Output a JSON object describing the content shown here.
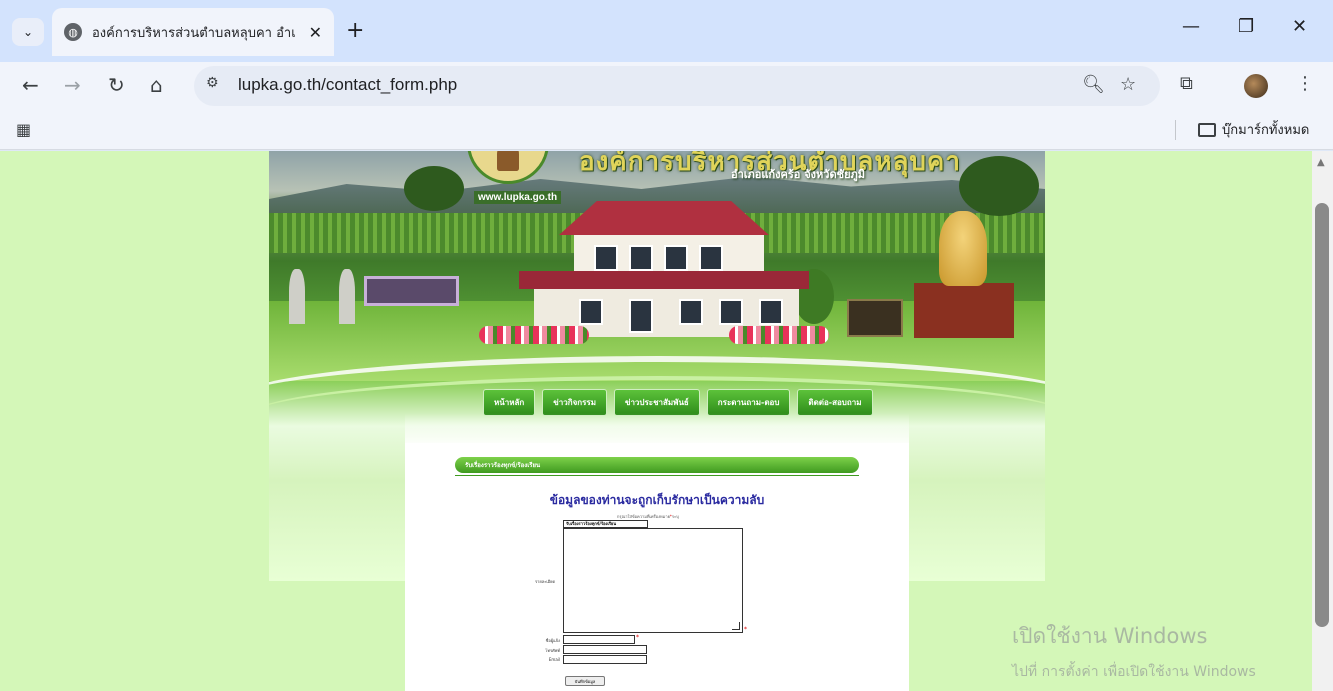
{
  "browser": {
    "tab_title": "องค์การบริหารส่วนตำบลหลุบคา อำเ",
    "url": "lupka.go.th/contact_form.php",
    "bookmarks_label": "บุ๊กมาร์กทั้งหมด"
  },
  "site": {
    "title": "องค์การบริหารส่วนตำบลหลุบคา",
    "subtitle": "อำเภอแก้งคร้อ จังหวัดชัยภูมิ",
    "url_badge": "www.lupka.go.th",
    "menu": [
      "หน้าหลัก",
      "ข่าวกิจกรรม",
      "ข่าวประชาสัมพันธ์",
      "กระดานถาม-ตอบ",
      "ติดต่อ-สอบถาม"
    ]
  },
  "form": {
    "header": "รับเรื่องราวร้องทุกข์/ร้องเรียน",
    "privacy_notice": "ข้อมูลของท่านจะถูกเก็บรักษาเป็นความลับ",
    "hint": "กรุณาใส่ข้อความที่เครื่องหมาย",
    "hint_suffix": "ระบุ",
    "subject_value": "รับเรื่องราวร้องทุกข์/ร้องเรียน",
    "detail_label": "รายละเอียด",
    "name_label": "ชื่อผู้แจ้ง",
    "phone_label": "โทรศัพท์",
    "email_label": "Email",
    "submit_label": "บันทึกข้อมูล"
  },
  "watermark": {
    "line1": "เปิดใช้งาน Windows",
    "line2": "ไปที่ การตั้งค่า เพื่อเปิดใช้งาน Windows"
  }
}
